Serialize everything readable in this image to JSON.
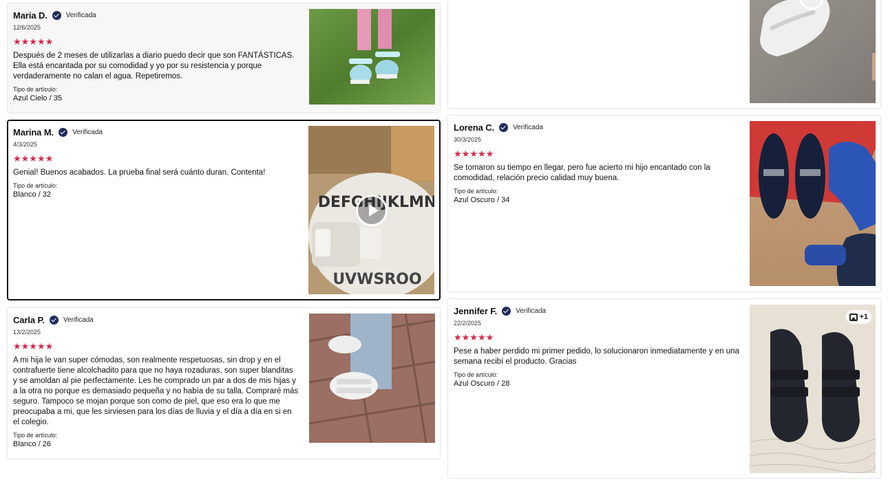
{
  "reviews": [
    {
      "name": "Maria D.",
      "verified": "Verificada",
      "date": "12/6/2025",
      "stars": "★★★★★",
      "rating": 5,
      "text": "Después de 2 meses de utilizarlas a diario puedo decir que son FANTÁSTICAS. Ella está encantada por su comodidad y yo por su resistencia y porque verdaderamente no calan el agua. Repetiremos.",
      "type_label": "Tipo de artículo:",
      "type_value": "Azul Cielo / 35"
    },
    {
      "name": "Marina M.",
      "verified": "Verificada",
      "date": "4/3/2025",
      "stars": "★★★★★",
      "rating": 5,
      "text": "Genial! Buenos acabados. La prueba final será cuánto duran. Contenta!",
      "type_label": "Tipo de artículo:",
      "type_value": "Blanco / 32",
      "media_text": "DEFGHIJKLMN"
    },
    {
      "name": "Carla P.",
      "verified": "Verificada",
      "date": "13/2/2025",
      "stars": "★★★★★",
      "rating": 5,
      "text": "A mi hija le van super cómodas, son realmente respetuosas, sin drop y en el contrafuerte tiene alcolchadito para que no haya rozaduras, son super blanditas y se amoldan al pie perfectamente. Les he comprado un par a dos de mis hijas y a la otra no porque es demasiado pequeña y no había de su talla. Compraré más seguro. Tampoco se mojan porque son como de piel, que eso era lo que me preocupaba a mi, que les sirviesen para los días de lluvia y el día a día en si en el colegio.",
      "type_label": "Tipo de artículo:",
      "type_value": "Blanco / 26"
    },
    {
      "name": "Lorena C.",
      "verified": "Verificada",
      "date": "30/3/2025",
      "stars": "★★★★★",
      "rating": 5,
      "text": "Se tomaron su tiempo en llegar, pero fue acierto mi hijo encantado con la comodidad, relación precio calidad muy buena.",
      "type_label": "Tipo de artículo:",
      "type_value": "Azul Oscuro / 34"
    },
    {
      "name": "Jennifer F.",
      "verified": "Verificada",
      "date": "22/2/2025",
      "stars": "★★★★★",
      "rating": 5,
      "text": "Pese a haber perdido mi primer pedido, lo solucionaron inmediatamente y en una semana recibí el producto. Gracias",
      "type_label": "Tipo de artículo:",
      "type_value": "Azul Oscuro / 28",
      "more_photos": "+1"
    }
  ],
  "colors": {
    "star": "#d6294f",
    "verified_badge": "#1f2b5b",
    "card_border": "#e6e6e6",
    "highlight_border": "#111111"
  }
}
